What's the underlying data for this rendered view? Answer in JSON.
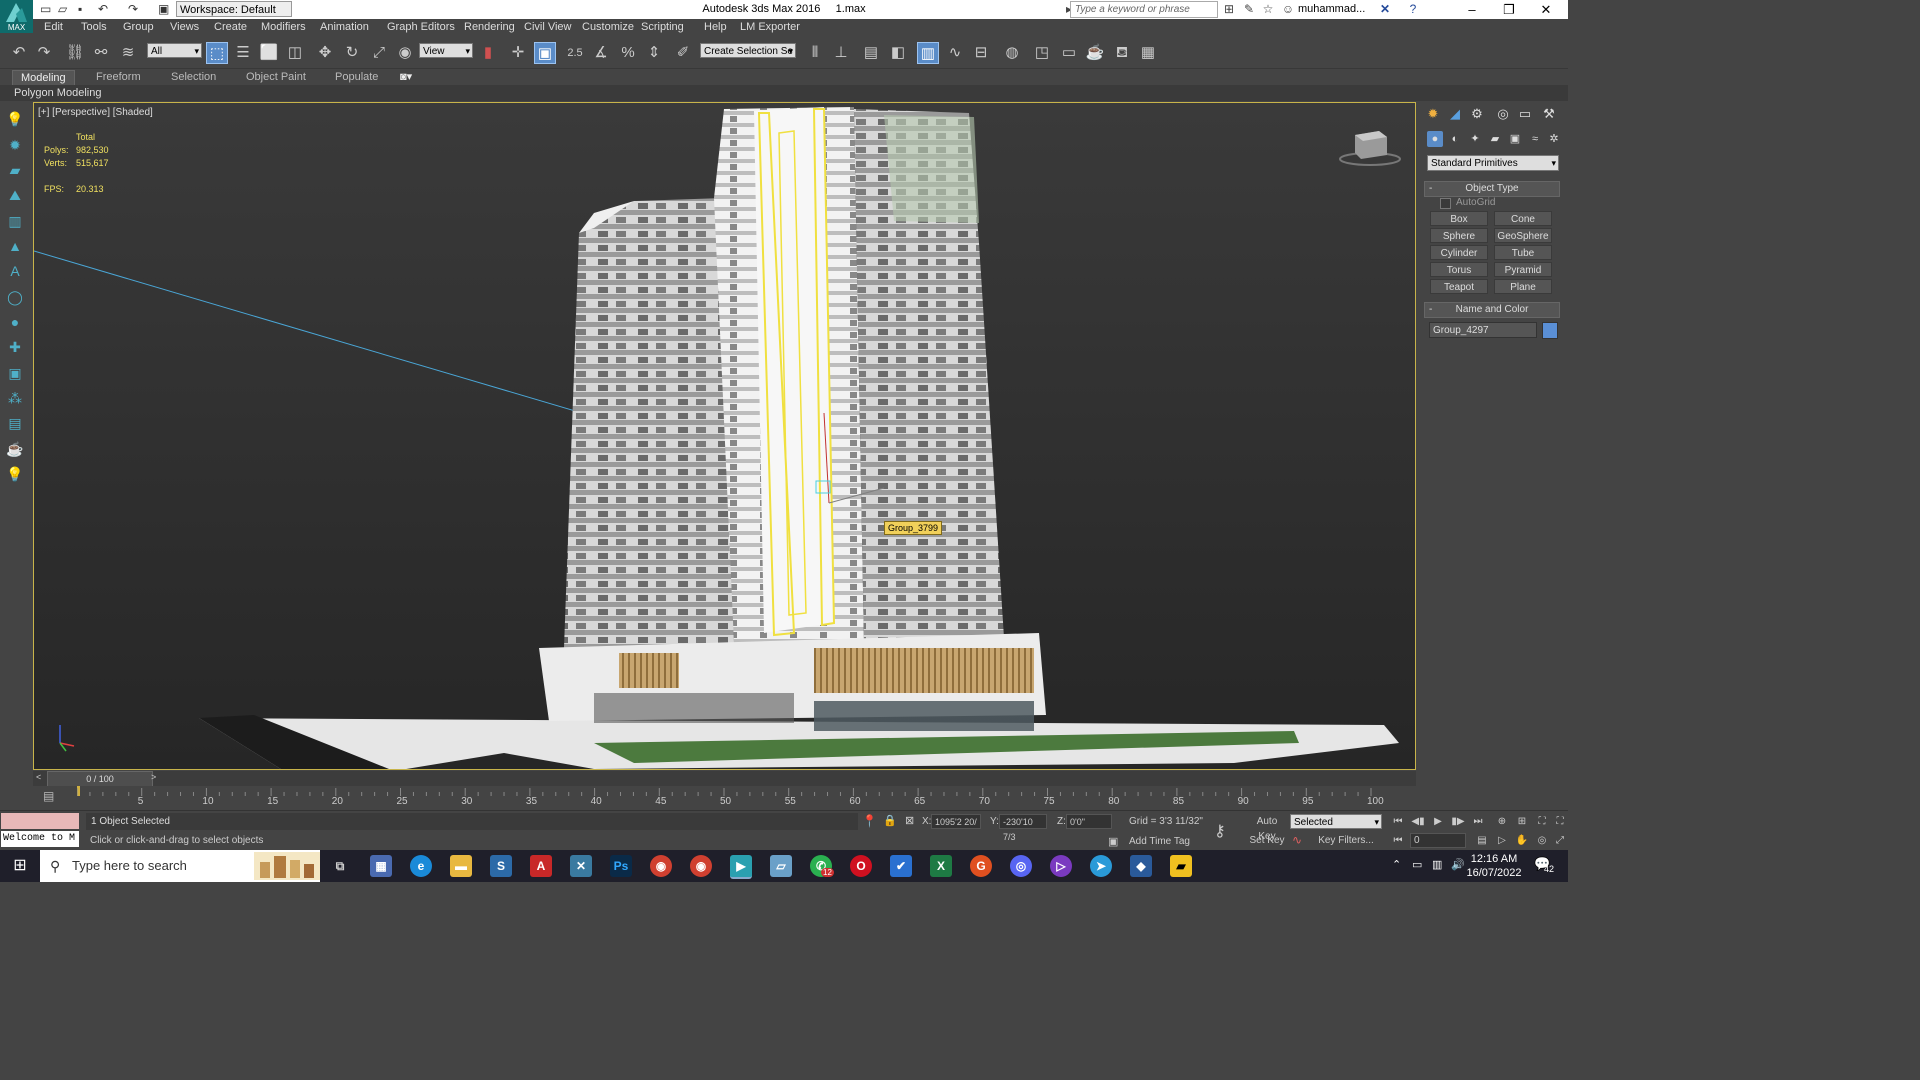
{
  "titlebar": {
    "workspace": "Workspace: Default",
    "app_title": "Autodesk 3ds Max 2016",
    "file_name": "1.max",
    "search_placeholder": "Type a keyword or phrase",
    "user": "muhammad...",
    "logo_text": "MAX"
  },
  "menu": [
    "Edit",
    "Tools",
    "Group",
    "Views",
    "Create",
    "Modifiers",
    "Animation",
    "Graph Editors",
    "Rendering",
    "Civil View",
    "Customize",
    "Scripting",
    "Help",
    "LM Exporter"
  ],
  "toolbar": {
    "filter_select": "All",
    "ref_coord": "View",
    "selection_set_placeholder": "Create Selection Se",
    "snap_label": "2.5"
  },
  "ribbon": {
    "tabs": [
      "Modeling",
      "Freeform",
      "Selection",
      "Object Paint",
      "Populate"
    ],
    "active_tab": "Modeling",
    "panel_label": "Polygon Modeling"
  },
  "viewport": {
    "label": "[+] [Perspective] [Shaded]",
    "stats_header": "Total",
    "polys_label": "Polys:",
    "polys": "982,530",
    "verts_label": "Verts:",
    "verts": "515,617",
    "fps_label": "FPS:",
    "fps": "20.313",
    "tooltip": "Group_3799",
    "selection_color": "#f0e040",
    "border_color": "#c8b44a"
  },
  "command_panel": {
    "category": "Standard Primitives",
    "object_type_title": "Object Type",
    "autogrid": "AutoGrid",
    "primitives": [
      "Box",
      "Cone",
      "Sphere",
      "GeoSphere",
      "Cylinder",
      "Tube",
      "Torus",
      "Pyramid",
      "Teapot",
      "Plane"
    ],
    "name_color_title": "Name and Color",
    "object_name": "Group_4297",
    "object_color": "#5a8fd6"
  },
  "timeline": {
    "frame_display": "0 / 100",
    "ticks": [
      "5",
      "10",
      "15",
      "20",
      "25",
      "30",
      "35",
      "40",
      "45",
      "50",
      "55",
      "60",
      "65",
      "70",
      "75",
      "80",
      "85",
      "90",
      "95",
      "100"
    ]
  },
  "status": {
    "maxscript_welcome": "Welcome to M",
    "selection": "1 Object Selected",
    "prompt": "Click or click-and-drag to select objects",
    "x_label": "X:",
    "x_value": "1095'2 20/",
    "y_label": "Y:",
    "y_value": "-230'10 7/3",
    "z_label": "Z:",
    "z_value": "0'0\"",
    "grid": "Grid = 3'3 11/32\"",
    "add_time_tag": "Add Time Tag",
    "auto_key": "Auto Key",
    "set_key": "Set Key",
    "key_mode": "Selected",
    "key_filters": "Key Filters...",
    "frame": "0"
  },
  "taskbar": {
    "search_placeholder": "Type here to search",
    "time": "12:16 AM",
    "date": "16/07/2022",
    "notifications": "42",
    "whatsapp_badge": "12"
  }
}
